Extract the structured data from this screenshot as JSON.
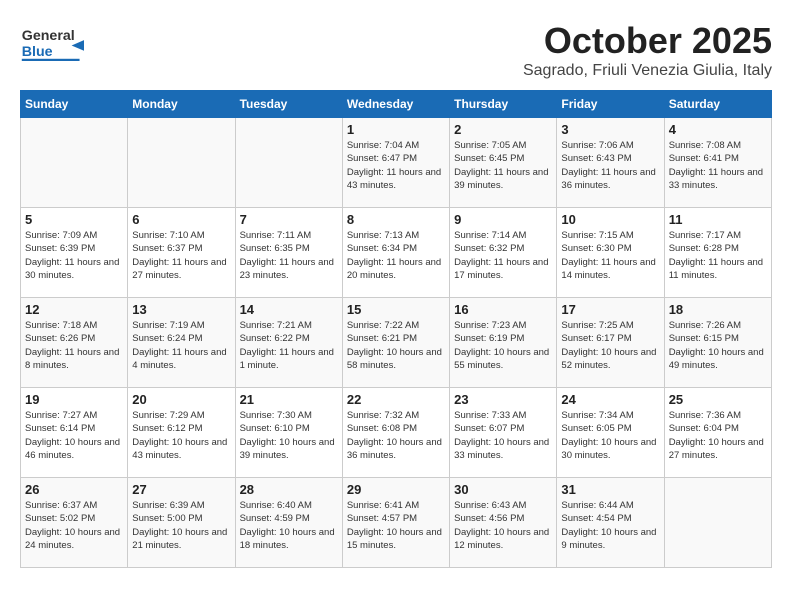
{
  "header": {
    "logo_general": "General",
    "logo_blue": "Blue",
    "title": "October 2025",
    "subtitle": "Sagrado, Friuli Venezia Giulia, Italy"
  },
  "weekdays": [
    "Sunday",
    "Monday",
    "Tuesday",
    "Wednesday",
    "Thursday",
    "Friday",
    "Saturday"
  ],
  "weeks": [
    [
      {
        "day": "",
        "info": ""
      },
      {
        "day": "",
        "info": ""
      },
      {
        "day": "",
        "info": ""
      },
      {
        "day": "1",
        "info": "Sunrise: 7:04 AM\nSunset: 6:47 PM\nDaylight: 11 hours\nand 43 minutes."
      },
      {
        "day": "2",
        "info": "Sunrise: 7:05 AM\nSunset: 6:45 PM\nDaylight: 11 hours\nand 39 minutes."
      },
      {
        "day": "3",
        "info": "Sunrise: 7:06 AM\nSunset: 6:43 PM\nDaylight: 11 hours\nand 36 minutes."
      },
      {
        "day": "4",
        "info": "Sunrise: 7:08 AM\nSunset: 6:41 PM\nDaylight: 11 hours\nand 33 minutes."
      }
    ],
    [
      {
        "day": "5",
        "info": "Sunrise: 7:09 AM\nSunset: 6:39 PM\nDaylight: 11 hours\nand 30 minutes."
      },
      {
        "day": "6",
        "info": "Sunrise: 7:10 AM\nSunset: 6:37 PM\nDaylight: 11 hours\nand 27 minutes."
      },
      {
        "day": "7",
        "info": "Sunrise: 7:11 AM\nSunset: 6:35 PM\nDaylight: 11 hours\nand 23 minutes."
      },
      {
        "day": "8",
        "info": "Sunrise: 7:13 AM\nSunset: 6:34 PM\nDaylight: 11 hours\nand 20 minutes."
      },
      {
        "day": "9",
        "info": "Sunrise: 7:14 AM\nSunset: 6:32 PM\nDaylight: 11 hours\nand 17 minutes."
      },
      {
        "day": "10",
        "info": "Sunrise: 7:15 AM\nSunset: 6:30 PM\nDaylight: 11 hours\nand 14 minutes."
      },
      {
        "day": "11",
        "info": "Sunrise: 7:17 AM\nSunset: 6:28 PM\nDaylight: 11 hours\nand 11 minutes."
      }
    ],
    [
      {
        "day": "12",
        "info": "Sunrise: 7:18 AM\nSunset: 6:26 PM\nDaylight: 11 hours\nand 8 minutes."
      },
      {
        "day": "13",
        "info": "Sunrise: 7:19 AM\nSunset: 6:24 PM\nDaylight: 11 hours\nand 4 minutes."
      },
      {
        "day": "14",
        "info": "Sunrise: 7:21 AM\nSunset: 6:22 PM\nDaylight: 11 hours\nand 1 minute."
      },
      {
        "day": "15",
        "info": "Sunrise: 7:22 AM\nSunset: 6:21 PM\nDaylight: 10 hours\nand 58 minutes."
      },
      {
        "day": "16",
        "info": "Sunrise: 7:23 AM\nSunset: 6:19 PM\nDaylight: 10 hours\nand 55 minutes."
      },
      {
        "day": "17",
        "info": "Sunrise: 7:25 AM\nSunset: 6:17 PM\nDaylight: 10 hours\nand 52 minutes."
      },
      {
        "day": "18",
        "info": "Sunrise: 7:26 AM\nSunset: 6:15 PM\nDaylight: 10 hours\nand 49 minutes."
      }
    ],
    [
      {
        "day": "19",
        "info": "Sunrise: 7:27 AM\nSunset: 6:14 PM\nDaylight: 10 hours\nand 46 minutes."
      },
      {
        "day": "20",
        "info": "Sunrise: 7:29 AM\nSunset: 6:12 PM\nDaylight: 10 hours\nand 43 minutes."
      },
      {
        "day": "21",
        "info": "Sunrise: 7:30 AM\nSunset: 6:10 PM\nDaylight: 10 hours\nand 39 minutes."
      },
      {
        "day": "22",
        "info": "Sunrise: 7:32 AM\nSunset: 6:08 PM\nDaylight: 10 hours\nand 36 minutes."
      },
      {
        "day": "23",
        "info": "Sunrise: 7:33 AM\nSunset: 6:07 PM\nDaylight: 10 hours\nand 33 minutes."
      },
      {
        "day": "24",
        "info": "Sunrise: 7:34 AM\nSunset: 6:05 PM\nDaylight: 10 hours\nand 30 minutes."
      },
      {
        "day": "25",
        "info": "Sunrise: 7:36 AM\nSunset: 6:04 PM\nDaylight: 10 hours\nand 27 minutes."
      }
    ],
    [
      {
        "day": "26",
        "info": "Sunrise: 6:37 AM\nSunset: 5:02 PM\nDaylight: 10 hours\nand 24 minutes."
      },
      {
        "day": "27",
        "info": "Sunrise: 6:39 AM\nSunset: 5:00 PM\nDaylight: 10 hours\nand 21 minutes."
      },
      {
        "day": "28",
        "info": "Sunrise: 6:40 AM\nSunset: 4:59 PM\nDaylight: 10 hours\nand 18 minutes."
      },
      {
        "day": "29",
        "info": "Sunrise: 6:41 AM\nSunset: 4:57 PM\nDaylight: 10 hours\nand 15 minutes."
      },
      {
        "day": "30",
        "info": "Sunrise: 6:43 AM\nSunset: 4:56 PM\nDaylight: 10 hours\nand 12 minutes."
      },
      {
        "day": "31",
        "info": "Sunrise: 6:44 AM\nSunset: 4:54 PM\nDaylight: 10 hours\nand 9 minutes."
      },
      {
        "day": "",
        "info": ""
      }
    ]
  ]
}
